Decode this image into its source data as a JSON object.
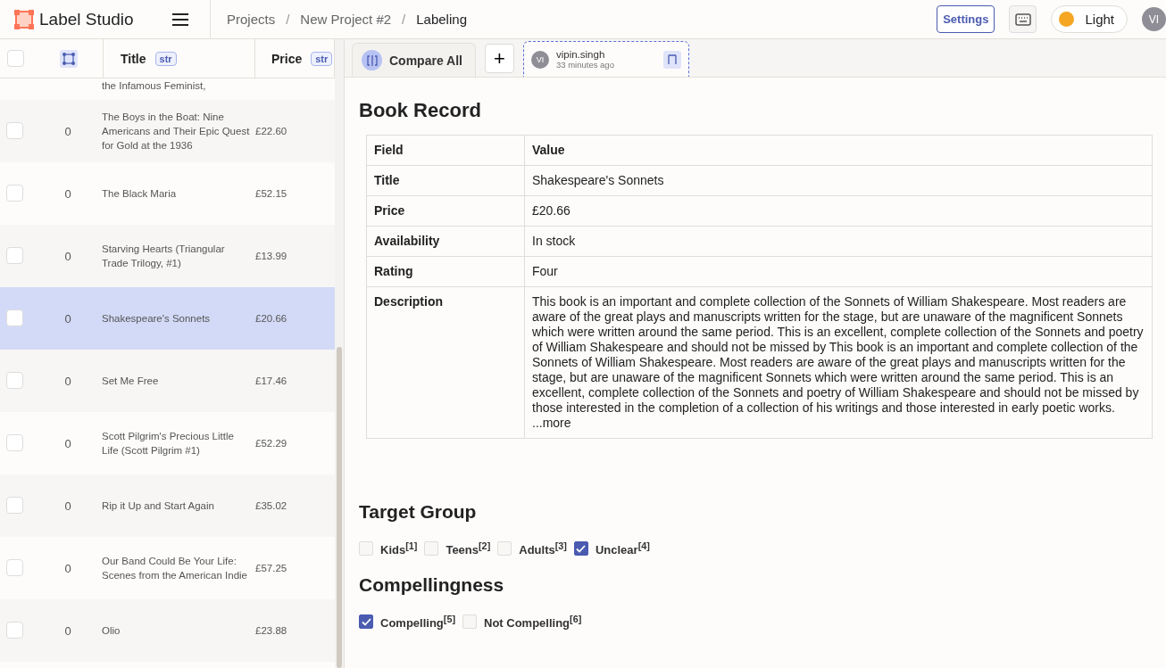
{
  "header": {
    "logo": "Label Studio",
    "breadcrumbs": [
      "Projects",
      "New Project #2",
      "Labeling"
    ],
    "separators": [
      "/",
      "/"
    ],
    "settings": "Settings",
    "theme": "Light",
    "avatar": "VI"
  },
  "table": {
    "columns": [
      {
        "kind": "check",
        "checked": false
      },
      {
        "kind": "icon"
      },
      {
        "kind": "text",
        "label": "Title",
        "tag": "str"
      },
      {
        "kind": "text",
        "label": "Price",
        "tag": "str"
      }
    ],
    "rows": [
      {
        "kind": "partial",
        "title": "the Infamous Feminist,",
        "selected": false
      },
      {
        "kind": "row",
        "count": "0",
        "title": "The Boys in the Boat: Nine Americans and Their Epic Quest for Gold at the 1936",
        "price": "£22.60",
        "selected": false
      },
      {
        "kind": "row",
        "count": "0",
        "title": "The Black Maria",
        "price": "£52.15",
        "selected": false
      },
      {
        "kind": "row",
        "count": "0",
        "title": "Starving Hearts (Triangular Trade Trilogy, #1)",
        "price": "£13.99",
        "selected": false
      },
      {
        "kind": "row",
        "count": "0",
        "title": "Shakespeare's Sonnets",
        "price": "£20.66",
        "selected": true
      },
      {
        "kind": "row",
        "count": "0",
        "title": "Set Me Free",
        "price": "£17.46",
        "selected": false
      },
      {
        "kind": "row",
        "count": "0",
        "title": "Scott Pilgrim's Precious Little Life (Scott Pilgrim #1)",
        "price": "£52.29",
        "selected": false
      },
      {
        "kind": "row",
        "count": "0",
        "title": "Rip it Up and Start Again",
        "price": "£35.02",
        "selected": false
      },
      {
        "kind": "row",
        "count": "0",
        "title": "Our Band Could Be Your Life: Scenes from the American Indie",
        "price": "£57.25",
        "selected": false
      },
      {
        "kind": "row",
        "count": "0",
        "title": "Olio",
        "price": "£23.88",
        "selected": false
      }
    ]
  },
  "tabs": {
    "compare": "Compare All",
    "plus": "+",
    "annotation": {
      "avatar": "VI",
      "user": "vipin.singh",
      "time": "33 minutes ago",
      "selected": true
    }
  },
  "record": {
    "title": "Book Record",
    "columns": [
      "Field",
      "Value"
    ],
    "rows": [
      [
        "Title",
        "Shakespeare's Sonnets"
      ],
      [
        "Price",
        "£20.66"
      ],
      [
        "Availability",
        "In stock"
      ],
      [
        "Rating",
        "Four"
      ],
      [
        "Description",
        "This book is an important and complete collection of the Sonnets of William Shakespeare. Most readers are aware of the great plays and manuscripts written for the stage, but are unaware of the magnificent Sonnets which were written around the same period. This is an excellent, complete collection of the Sonnets and poetry of William Shakespeare and should not be missed by This book is an important and complete collection of the Sonnets of William Shakespeare. Most readers are aware of the great plays and manuscripts written for the stage, but are unaware of the magnificent Sonnets which were written around the same period. This is an excellent, complete collection of the Sonnets and poetry of William Shakespeare and should not be missed by those interested in the completion of a collection of his writings and those interested in early poetic works. ...more"
      ]
    ]
  },
  "groups": [
    {
      "title": "Target Group",
      "options": [
        {
          "label": "Kids$^{[1]}$",
          "checked": false
        },
        {
          "label": "Teens$^{[2]}$",
          "checked": false
        },
        {
          "label": "Adults$^{[3]}$",
          "checked": false
        },
        {
          "label": "Unclear$^{[4]}$",
          "checked": true
        }
      ]
    },
    {
      "title": "Compellingness",
      "options": [
        {
          "label": "Compelling$^{[5]}$",
          "checked": true
        },
        {
          "label": "Not Compelling$^{[6]}$",
          "checked": false
        }
      ]
    }
  ]
}
